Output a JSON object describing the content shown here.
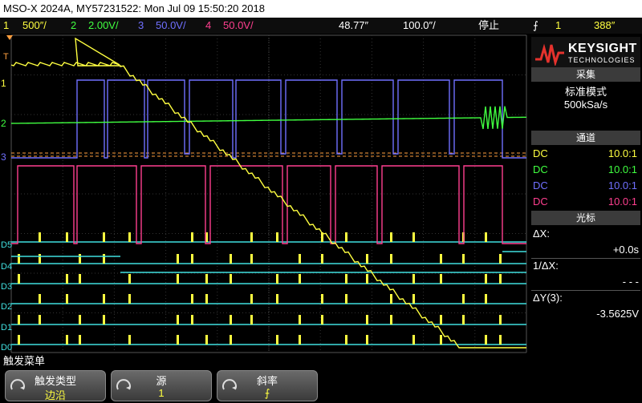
{
  "title": "MSO-X 2024A, MY57231522: Mon Jul 09 15:50:20 2018",
  "status": {
    "ch1_num": "1",
    "ch1_scale": "500″/",
    "ch2_num": "2",
    "ch2_scale": "2.00V/",
    "ch3_num": "3",
    "ch3_scale": "50.0V/",
    "ch4_num": "4",
    "ch4_scale": "50.0V/",
    "delay": "48.77″",
    "timebase": "100.0″/",
    "run_state": "停止",
    "trig_slope": "⨍",
    "trig_src": "1",
    "trig_level": "388″"
  },
  "brand": {
    "name": "KEYSIGHT",
    "sub": "TECHNOLOGIES"
  },
  "acquire": {
    "header": "采集",
    "mode": "标准模式",
    "rate": "500kSa/s"
  },
  "channels": {
    "header": "通道",
    "rows": [
      {
        "coupling": "DC",
        "probe": "10.0:1",
        "color": "#ffff40"
      },
      {
        "coupling": "DC",
        "probe": "10.0:1",
        "color": "#40ff40"
      },
      {
        "coupling": "DC",
        "probe": "10.0:1",
        "color": "#7070ff"
      },
      {
        "coupling": "DC",
        "probe": "10.0:1",
        "color": "#ff3f8f"
      }
    ]
  },
  "cursors": {
    "header": "光标",
    "dx_label": "ΔX:",
    "dx_value": "+0.0s",
    "inv_label": "1/ΔX:",
    "inv_value": "- - -",
    "dy_label": "ΔY(3):",
    "dy_value": "-3.5625V"
  },
  "markers": {
    "ch1": "1",
    "ch2": "2",
    "ch3": "3",
    "trig": "T",
    "digital": [
      "D5",
      "D4",
      "D3",
      "D2",
      "D1",
      "D0"
    ]
  },
  "menu": {
    "title": "触发菜单"
  },
  "softkeys": [
    {
      "label": "触发类型",
      "value": "边沿"
    },
    {
      "label": "源",
      "value": "1"
    },
    {
      "label": "斜率",
      "value": "⨍"
    }
  ],
  "colors": {
    "ch1": "#ffff40",
    "ch2": "#40ff40",
    "ch3": "#7070ff",
    "ch4": "#ff3f8f",
    "digital": "#40e0e0"
  }
}
